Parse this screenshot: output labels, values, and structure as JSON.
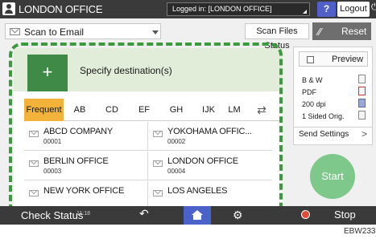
{
  "topbar": {
    "title": "LONDON OFFICE",
    "login_status": "Logged in: [LONDON OFFICE]",
    "help_label": "?",
    "logout_label": "Logout",
    "power_glyph": "⏻"
  },
  "toolbar": {
    "scan_mode": "Scan to Email",
    "scan_files_status": "Scan Files Status",
    "reset_label": "Reset"
  },
  "destination": {
    "add_glyph": "+",
    "label": "Specify destination(s)"
  },
  "tabs": [
    "Frequent",
    "AB",
    "CD",
    "EF",
    "GH",
    "IJK",
    "LM"
  ],
  "tab_scroll_glyph": "⇄",
  "entries": [
    {
      "name": "ABCD COMPANY",
      "number": "00001"
    },
    {
      "name": "YOKOHAMA OFFIC...",
      "number": "00002"
    },
    {
      "name": "BERLIN OFFICE",
      "number": "00003"
    },
    {
      "name": "LONDON OFFICE",
      "number": "00004"
    },
    {
      "name": "NEW YORK OFFICE",
      "number": ""
    },
    {
      "name": "LOS ANGELES",
      "number": ""
    }
  ],
  "settings_panel": {
    "preview_label": "Preview",
    "color": "B & W",
    "file_type": "PDF",
    "resolution": "200 dpi",
    "sides": "1 Sided Orig.",
    "send_settings": "Send Settings",
    "send_arrow": ">"
  },
  "start_label": "Start",
  "bottombar": {
    "check_status": "Check Status",
    "time": "11:18",
    "back_glyph": "↶",
    "gear_glyph": "⚙",
    "stop_label": "Stop"
  },
  "figure_id": "EBW233",
  "colors": {
    "accent_green": "#3b9a3b",
    "active_tab": "#f3b23a",
    "home_blue": "#4b62c8",
    "start_green": "#7dc88a"
  }
}
